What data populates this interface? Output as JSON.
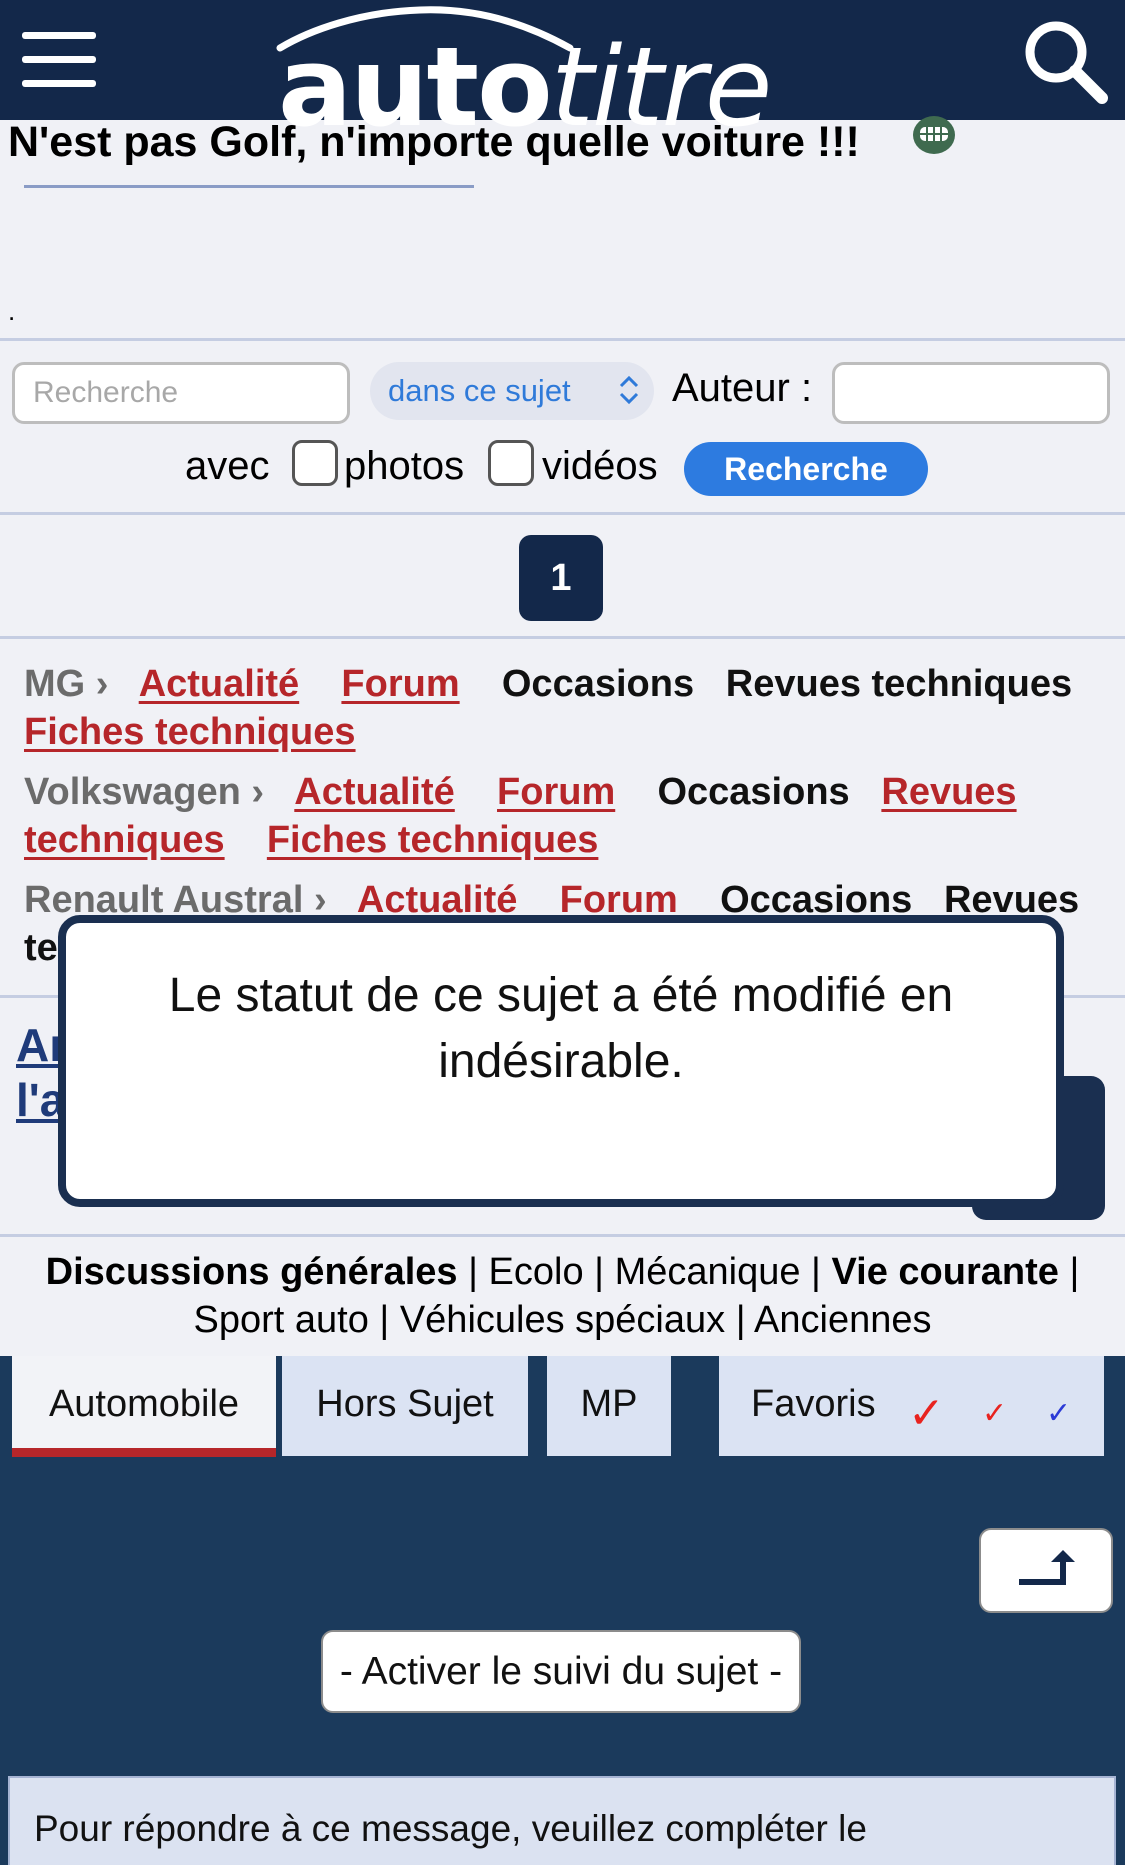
{
  "header": {
    "logo_bold": "auto",
    "logo_light": "titre"
  },
  "topic": {
    "title": "N'est pas Golf, n'importe quelle voiture !!!",
    "body": "."
  },
  "search": {
    "placeholder": "Recherche",
    "scope": "dans ce sujet",
    "author_label": "Auteur :",
    "author_value": "",
    "with_label": "avec",
    "photos_label": "photos",
    "videos_label": "vidéos",
    "button_label": "Recherche"
  },
  "pagination": {
    "current": "1"
  },
  "links": {
    "mg": {
      "brand": "MG ›",
      "news": "Actualité",
      "forum": "Forum",
      "used": "Occasions",
      "reviews": "Revues techniques",
      "specs": "Fiches techniques"
    },
    "vw": {
      "brand": "Volkswagen ›",
      "news": "Actualité",
      "forum": "Forum",
      "used": "Occasions",
      "reviews_1": "Revues",
      "reviews_2": "techniques",
      "specs": "Fiches techniques"
    },
    "renault": {
      "brand": "Renault Austral ›",
      "news": "Actualité",
      "forum": "Forum",
      "used": "Occasions",
      "reviews": "Revues",
      "cut": "te"
    }
  },
  "article_link": {
    "line1": "Aı",
    "line2": "l'a"
  },
  "modal": {
    "message": "Le statut de ce sujet a été modifié en indésirable."
  },
  "categories": {
    "general": "Discussions générales",
    "eco": "Ecolo",
    "mechanics": "Mécanique",
    "daily": "Vie courante",
    "sport": "Sport auto",
    "special": "Véhicules spéciaux",
    "old": "Anciennes",
    "sep": " | "
  },
  "tabs": {
    "automobile": "Automobile",
    "offtopic": "Hors Sujet",
    "mp": "MP",
    "favorites": "Favoris",
    "check_glyph": "✓"
  },
  "colors": {
    "check_red": "#e8231f",
    "check_red_small": "#e8231f",
    "check_blue": "#2b3ad6"
  },
  "actions": {
    "follow": "- Activer le suivi du sujet -"
  },
  "reply": {
    "text": "Pour répondre à ce message, veuillez compléter le"
  }
}
